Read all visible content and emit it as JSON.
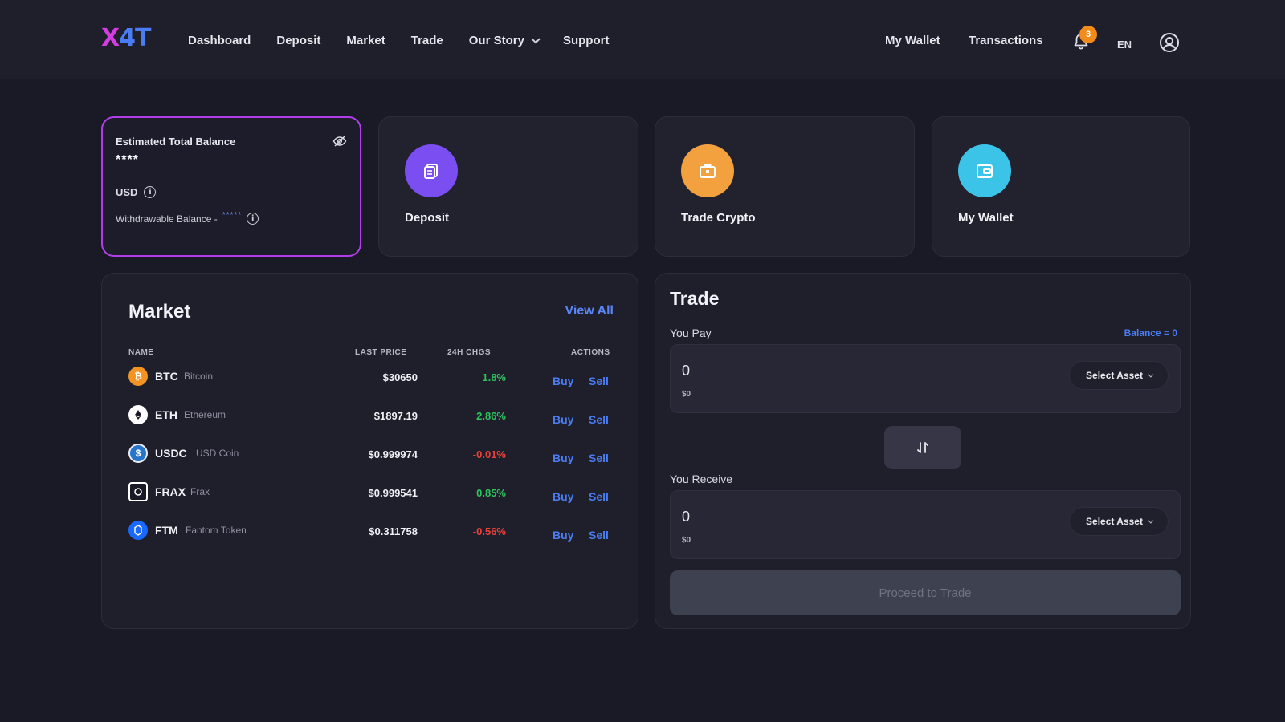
{
  "brand": {
    "logo_x": "X",
    "logo_rest": "4T"
  },
  "nav": {
    "dashboard": "Dashboard",
    "deposit": "Deposit",
    "market": "Market",
    "trade": "Trade",
    "our_story": "Our Story",
    "support": "Support",
    "my_wallet": "My Wallet",
    "transactions": "Transactions",
    "notification_count": "3",
    "language": "EN"
  },
  "balance_card": {
    "title": "Estimated Total Balance",
    "masked_value": "****",
    "currency": "USD",
    "withdrawable_label": "Withdrawable Balance -",
    "withdrawable_masked": "*****"
  },
  "actions": {
    "deposit": "Deposit",
    "trade_crypto": "Trade Crypto",
    "my_wallet": "My Wallet"
  },
  "market": {
    "title": "Market",
    "view_all": "View All",
    "headers": {
      "name": "NAME",
      "last_price": "LAST PRICE",
      "change": "24H CHGS",
      "actions": "ACTIONS"
    },
    "buy_label": "Buy",
    "sell_label": "Sell",
    "rows": [
      {
        "symbol": "BTC",
        "name": "Bitcoin",
        "price": "$30650",
        "change": "1.8%",
        "direction": "up",
        "icon_color": "#f39322",
        "icon": "bitcoin-icon"
      },
      {
        "symbol": "ETH",
        "name": "Ethereum",
        "price": "$1897.19",
        "change": "2.86%",
        "direction": "up",
        "icon_color": "#ffffff",
        "icon": "ethereum-icon"
      },
      {
        "symbol": "USDC",
        "name": "USD Coin",
        "price": "$0.999974",
        "change": "-0.01%",
        "direction": "down",
        "icon_color": "#2775ca",
        "icon": "usdc-icon"
      },
      {
        "symbol": "FRAX",
        "name": "Frax",
        "price": "$0.999541",
        "change": "0.85%",
        "direction": "up",
        "icon_color": "#1a1a26",
        "icon": "frax-icon"
      },
      {
        "symbol": "FTM",
        "name": "Fantom Token",
        "price": "$0.311758",
        "change": "-0.56%",
        "direction": "down",
        "icon_color": "#1969ff",
        "icon": "fantom-icon"
      }
    ]
  },
  "trade": {
    "title": "Trade",
    "you_pay": "You Pay",
    "balance": "Balance = 0",
    "pay_value": "0",
    "pay_usd": "$0",
    "select_asset": "Select Asset",
    "you_receive": "You Receive",
    "receive_value": "0",
    "receive_usd": "$0",
    "proceed": "Proceed to Trade"
  },
  "colors": {
    "accent_blue": "#4a7cf3",
    "accent_purple": "#b13ce8",
    "positive": "#2ec25c",
    "negative": "#e8413b"
  }
}
